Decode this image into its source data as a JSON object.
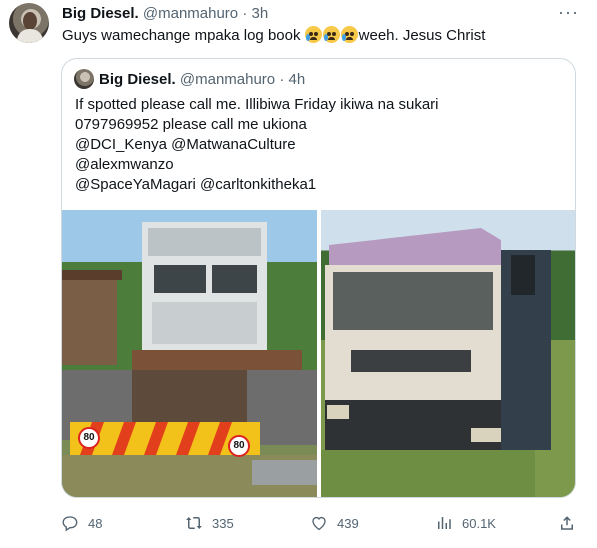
{
  "tweet": {
    "author_name": "Big Diesel.",
    "author_handle": "@manmahuro",
    "separator": "·",
    "time": "3h",
    "more_label": "···",
    "text_before": "Guys wamechange mpaka log book ",
    "emoji": "loudly-crying-face",
    "text_after": "weeh. Jesus Christ"
  },
  "quote": {
    "author_name": "Big Diesel.",
    "author_handle": "@manmahuro",
    "separator": "·",
    "time": "4h",
    "lines": [
      "If spotted please call me. Illibiwa Friday ikiwa na sukari",
      "0797969952 please call me ukiona",
      "@DCI_Kenya @MatwanaCulture",
      "@alexmwanzo",
      "@SpaceYaMagari @carltonkitheka1"
    ],
    "photos": [
      "truck-rear-chassis-photo",
      "truck-front-cab-photo"
    ],
    "plate_marker": "80"
  },
  "actions": {
    "replies": "48",
    "reposts": "335",
    "likes": "439",
    "views": "60.1K"
  },
  "colors": {
    "text": "#0f1419",
    "muted": "#536471",
    "border": "#cfd9de"
  }
}
